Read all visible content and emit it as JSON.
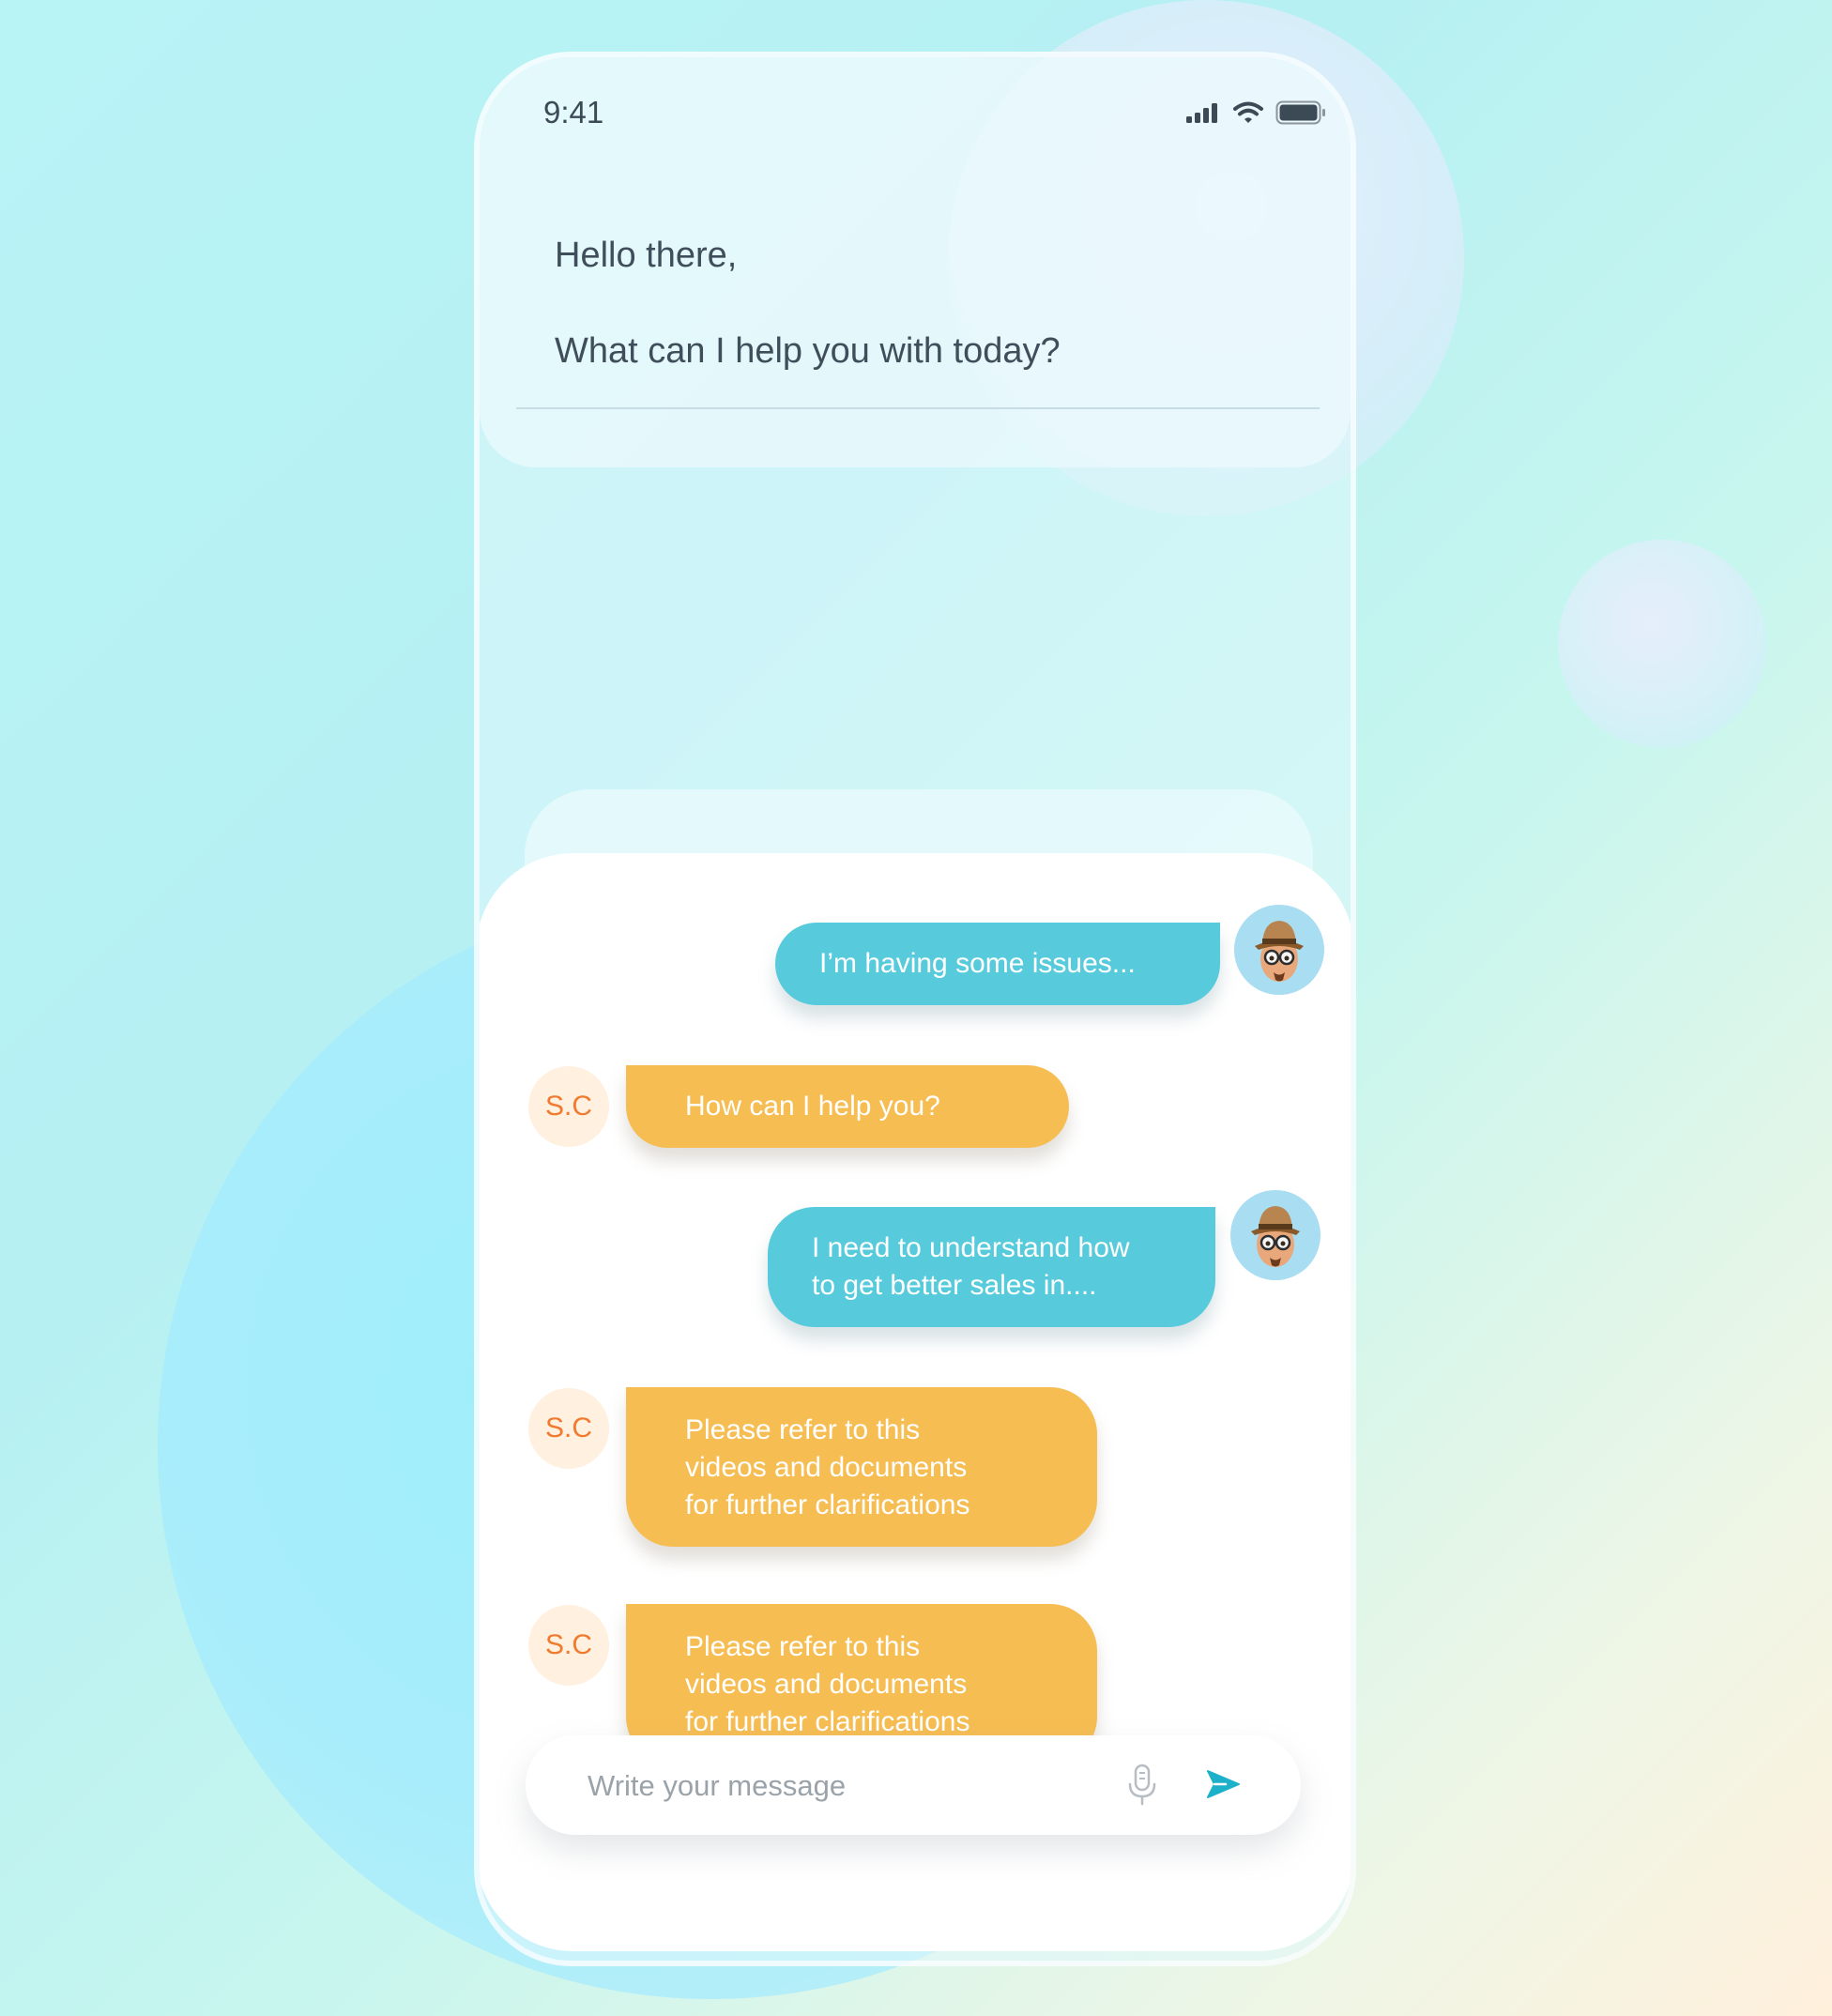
{
  "status_bar": {
    "time": "9:41",
    "icons": [
      "cellular-signal-icon",
      "wifi-icon",
      "battery-icon"
    ]
  },
  "header": {
    "greeting": "Hello there,",
    "question": "What can I help you with today?"
  },
  "messages": [
    {
      "sender": "user",
      "text": "I’m having some issues..."
    },
    {
      "sender": "bot",
      "initials": "S.C",
      "text": "How can I help you?"
    },
    {
      "sender": "user",
      "lines": [
        "I need to understand how",
        "to get better sales in...."
      ]
    },
    {
      "sender": "bot",
      "initials": "S.C",
      "lines": [
        "Please refer to this",
        "videos and documents",
        "for further clarifications"
      ]
    },
    {
      "sender": "bot",
      "initials": "S.C",
      "lines": [
        "Please refer to this",
        "videos and documents",
        "for further clarifications"
      ]
    }
  ],
  "composer": {
    "placeholder": "Write your message",
    "mic_icon": "microphone-icon",
    "send_icon": "send-icon"
  },
  "colors": {
    "user_bubble": "#57cbdc",
    "bot_bubble": "#f6bd52",
    "bot_initials": "#f07a2d",
    "send_accent": "#1cb0c9"
  }
}
